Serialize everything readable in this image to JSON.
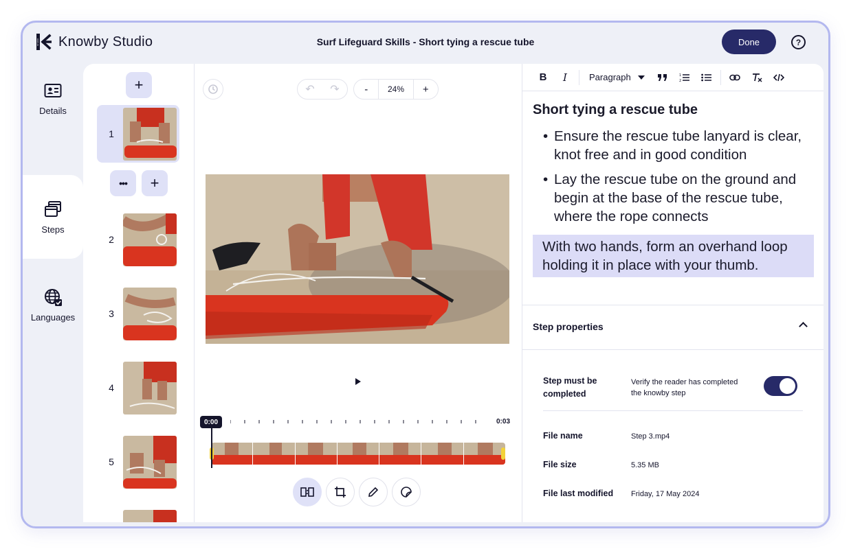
{
  "app": {
    "brand": "Knowby Studio",
    "logo_small_text": "STUDIO",
    "title": "Surf Lifeguard Skills - Short tying a rescue tube"
  },
  "header": {
    "done_label": "Done",
    "help_icon": "question-circle-icon"
  },
  "nav": {
    "items": [
      {
        "label": "Details",
        "icon": "id-card-icon",
        "active": false
      },
      {
        "label": "Steps",
        "icon": "stacked-windows-icon",
        "active": true
      },
      {
        "label": "Languages",
        "icon": "globe-check-icon",
        "active": false
      }
    ]
  },
  "steps": {
    "add_label": "+",
    "more_label": "•••",
    "items": [
      {
        "number": "1",
        "selected": true
      },
      {
        "number": "2",
        "selected": false
      },
      {
        "number": "3",
        "selected": false
      },
      {
        "number": "4",
        "selected": false
      },
      {
        "number": "5",
        "selected": false
      }
    ]
  },
  "canvas": {
    "zoom": "24%",
    "zoom_minus": "-",
    "zoom_plus": "+",
    "time_start": "0:00",
    "time_end": "0:03",
    "tools": [
      "replace-media-icon",
      "crop-icon",
      "pencil-icon",
      "sticker-icon"
    ]
  },
  "editor": {
    "toolbar": {
      "bold": "B",
      "italic": "I",
      "format": "Paragraph"
    },
    "heading": "Short tying a rescue tube",
    "bullets": [
      "Ensure the rescue tube lanyard is clear, knot free and in good condition",
      "Lay the rescue tube on the ground and begin at the base of the rescue tube, where the rope connects"
    ],
    "highlighted": "With two hands, form an overhand loop holding it in place with your thumb."
  },
  "properties": {
    "title": "Step properties",
    "must_complete_label": "Step must be completed",
    "must_complete_desc": "Verify the reader has completed the knowby step",
    "must_complete_on": true,
    "file_name_label": "File name",
    "file_name": "Step 3.mp4",
    "file_size_label": "File size",
    "file_size": "5.35 MB",
    "modified_label": "File last modified",
    "modified": "Friday, 17 May 2024"
  },
  "colors": {
    "accent": "#272a68",
    "selection": "#dfe1f7",
    "highlight": "#dcdcf7",
    "frame": "#b3b8ef",
    "tube_red": "#d9341f",
    "sand": "#c9b9a0"
  }
}
